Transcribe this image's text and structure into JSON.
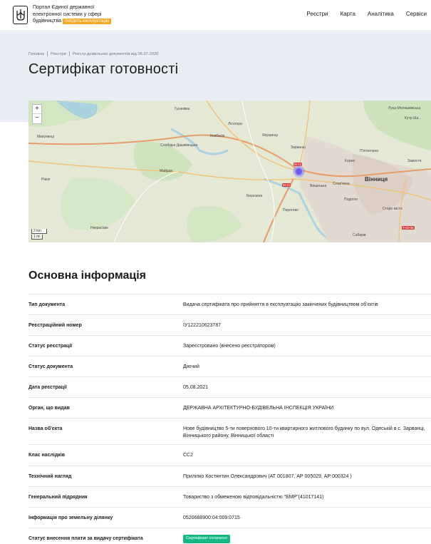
{
  "header": {
    "brand_line1": "Портал Єдиної державної",
    "brand_line2": "електронної системи у сфері",
    "brand_line3": "будівництва",
    "brand_badge": "Dосдить експлуатацію",
    "nav": [
      "Реєстри",
      "Карта",
      "Аналітика",
      "Сервіси"
    ]
  },
  "breadcrumbs": [
    "Головна",
    "Реєстри",
    "Реєстр дозвільних документів від 06.07.2020"
  ],
  "page_title": "Сертифікат готовності",
  "map": {
    "zoom_in": "+",
    "zoom_out": "−",
    "scale_km": "2 km",
    "scale_mi": "1 mi",
    "labels": {
      "hushkov": "Гусачівка",
      "kovbasiv": "Ковбасів",
      "lisohora": "Лісогора",
      "yakushynci": "Якушинці",
      "mykulyntsi": "Микулинці",
      "slobidka": "Слобідка Дашківецька",
      "zarvanci": "Зарванці",
      "pyatnychany": "П'ятничани",
      "koreya": "Корея",
      "zamostia": "Замостя",
      "vinnytsia": "Вінниця",
      "vyshenka": "Вишенька",
      "slovianka": "Слов'янка",
      "podillia": "Поділля",
      "stare_misto": "Старе місто",
      "pyrohovo": "Пирогово",
      "berezyna": "Березина",
      "maidan": "Майдан",
      "rivok": "Рівок",
      "nekrasove": "Некрасове",
      "sabarov": "Сабарів",
      "kutch": "Кутр Ша...",
      "lukashivka": "Лука-Мелешківська",
      "m12": "M-12",
      "m21": "M-21",
      "t0206": "T-02-06"
    }
  },
  "section_title": "Основна інформація",
  "info_rows": [
    {
      "key": "Тип документа",
      "value": "Видача сертифіката про прийняття в експлуатацію закінчених будівництвом об'єктів"
    },
    {
      "key": "Реєстраційний номер",
      "value": "ІУ122210623787"
    },
    {
      "key": "Статус реєстрації",
      "value": "Зареєстровано (внесено реєстратором)"
    },
    {
      "key": "Статус документа",
      "value": "Діючий"
    },
    {
      "key": "Дата реєстрації",
      "value": "05.08.2021"
    },
    {
      "key": "Орган, що видав",
      "value": "ДЕРЖАВНА АРХІТЕКТУРНО-БУДІВЕЛЬНА ІНСПЕКЦІЯ УКРАЇНИ"
    },
    {
      "key": "Назва об'єкта",
      "value": "Нове будівництво 5-ти поверхового 10-ти квартирного житлового будинку по вул. Одеській в с. Зарванці, Вінницького району, Вінницької області"
    },
    {
      "key": "Клас наслідків",
      "value": "СС2"
    },
    {
      "key": "Технічний нагляд",
      "value": "Приліпко Костянтин Олександрович (АТ 001807, АР 005029, АР 000324 )"
    },
    {
      "key": "Генеральний підрядник",
      "value": "Товариство з обмеженою відповідальністю \"БМР\"(41017141)"
    },
    {
      "key": "Інформація про земельну ділянку",
      "value": "0520688900:04:009:0715"
    },
    {
      "key": "Статус внесення плати за видачу сертифіката",
      "value": "Сертифікат сплачено"
    }
  ],
  "colors": {
    "accent_badge": "#f5a623",
    "status_paid": "#16b885",
    "marker": "#6c5ce7"
  }
}
